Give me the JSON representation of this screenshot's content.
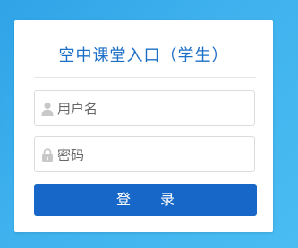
{
  "login": {
    "title": "空中课堂入口（学生）",
    "username_placeholder": "用户名",
    "password_placeholder": "密码",
    "submit_label": "登 录"
  },
  "icons": {
    "username": "user-icon",
    "password": "lock-icon"
  },
  "colors": {
    "background": "#3aaeec",
    "title": "#1b6fc6",
    "button": "#1767c8"
  }
}
